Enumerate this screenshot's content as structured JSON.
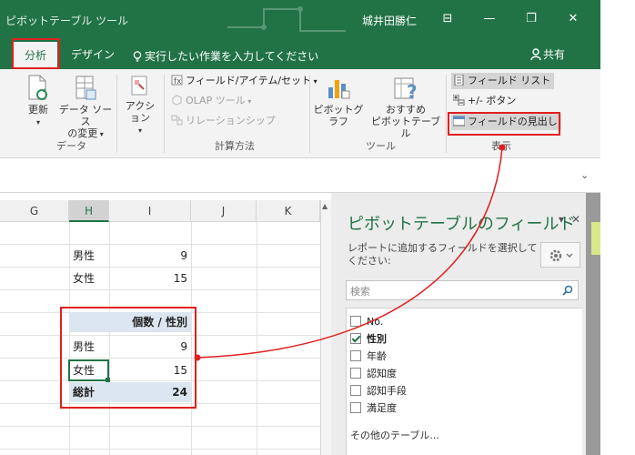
{
  "titlebar": {
    "app_title": "ピボットテーブル ツール",
    "user": "城井田勝仁",
    "controls": [
      "⊟",
      "—",
      "❐",
      "✕"
    ]
  },
  "tabs": {
    "analyze": "分析",
    "design": "デザイン",
    "tellme": "実行したい作業を入力してください",
    "share": "共有"
  },
  "ribbon": {
    "refresh": "更新",
    "change_source": [
      "データ ソース",
      "の変更"
    ],
    "action": "アクション",
    "fields_items_sets": "フィールド/アイテム/セット",
    "olap_tools": "OLAP ツール",
    "relationships": "リレーションシップ",
    "pivot_chart": "ピボットグラフ",
    "recommended": [
      "おすすめ",
      "ピボットテーブル"
    ],
    "field_list": "フィールド リスト",
    "plus_minus": "+/- ボタン",
    "field_headers": "フィールドの見出し",
    "groups": {
      "data": "データ",
      "calculations": "計算方法",
      "tools": "ツール",
      "show": "表示"
    }
  },
  "grid": {
    "columns": [
      "G",
      "H",
      "I",
      "J",
      "K"
    ],
    "summary": [
      {
        "label": "男性",
        "value": "9"
      },
      {
        "label": "女性",
        "value": "15"
      }
    ],
    "pivot": {
      "header": "個数 / 性別",
      "rows": [
        {
          "label": "男性",
          "value": "9"
        },
        {
          "label": "女性",
          "value": "15"
        }
      ],
      "total_label": "総計",
      "total_value": "24"
    }
  },
  "pane": {
    "title": "ピボットテーブルのフィールド",
    "desc": "レポートに追加するフィールドを選択してください:",
    "search_placeholder": "検索",
    "fields": [
      {
        "name": "No.",
        "checked": false
      },
      {
        "name": "性別",
        "checked": true
      },
      {
        "name": "年齢",
        "checked": false
      },
      {
        "name": "認知度",
        "checked": false
      },
      {
        "name": "認知手段",
        "checked": false
      },
      {
        "name": "満足度",
        "checked": false
      }
    ],
    "other_tables": "その他のテーブル..."
  },
  "colors": {
    "excel_green": "#217346",
    "highlight_red": "#e02020",
    "pivot_blue": "#dce6f0"
  }
}
